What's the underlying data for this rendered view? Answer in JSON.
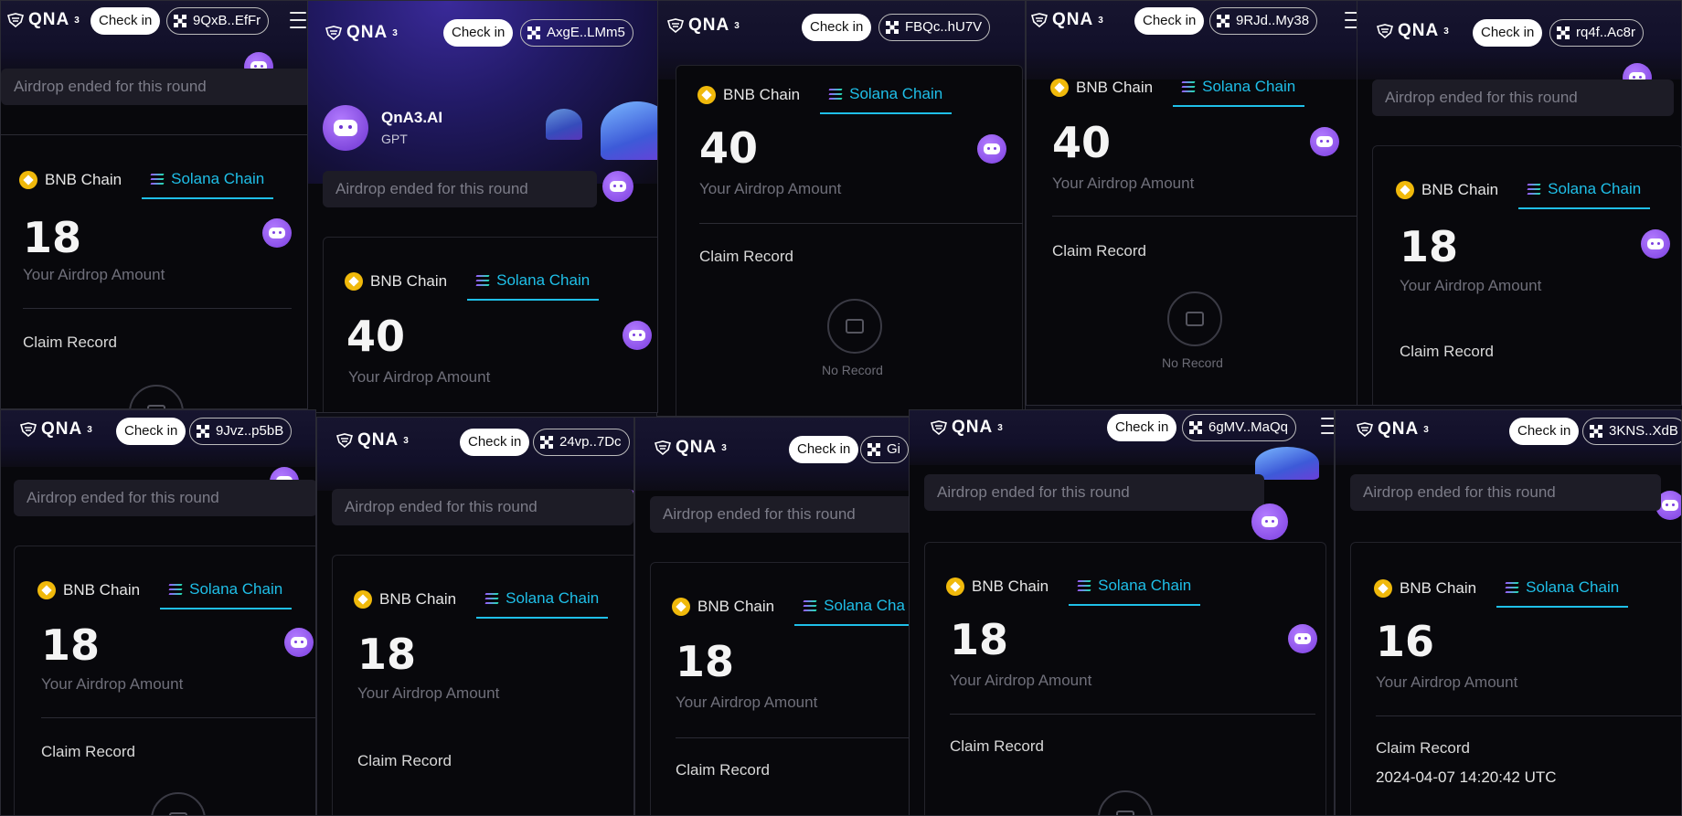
{
  "brand": {
    "logo_text": "QNA",
    "logo_sup": "3"
  },
  "labels": {
    "check_in": "Check in",
    "airdrop_ended": "Airdrop ended for this round",
    "bnb_chain": "BNB Chain",
    "solana_chain": "Solana Chain",
    "solana_chain_cut": "Solana Cha",
    "your_airdrop_amount": "Your Airdrop Amount",
    "claim_record": "Claim Record",
    "no_record": "No Record"
  },
  "profile": {
    "name": "QnA3.AI",
    "subtitle": "GPT"
  },
  "panels": [
    {
      "wallet": "9QxB..EfFr",
      "amount": "18"
    },
    {
      "wallet": "AxgE..LMm5",
      "amount": "40"
    },
    {
      "wallet": "FBQc..hU7V",
      "amount": "40"
    },
    {
      "wallet": "9RJd..My38",
      "amount": "40"
    },
    {
      "wallet": "rq4f..Ac8r",
      "amount": "18"
    },
    {
      "wallet": "9Jvz..p5bB",
      "amount": "18"
    },
    {
      "wallet": "24vp..7Dc",
      "amount": "18"
    },
    {
      "wallet": "Gi",
      "amount": "18"
    },
    {
      "wallet": "6gMV..MaQq",
      "amount": "18"
    },
    {
      "wallet": "3KNS..XdB",
      "amount": "16",
      "record_time": "2024-04-07 14:20:42 UTC"
    }
  ],
  "colors": {
    "accent": "#1fbfe8",
    "bnb": "#f0b90b",
    "robot": "#8b4ff0",
    "background": "#08080c"
  }
}
